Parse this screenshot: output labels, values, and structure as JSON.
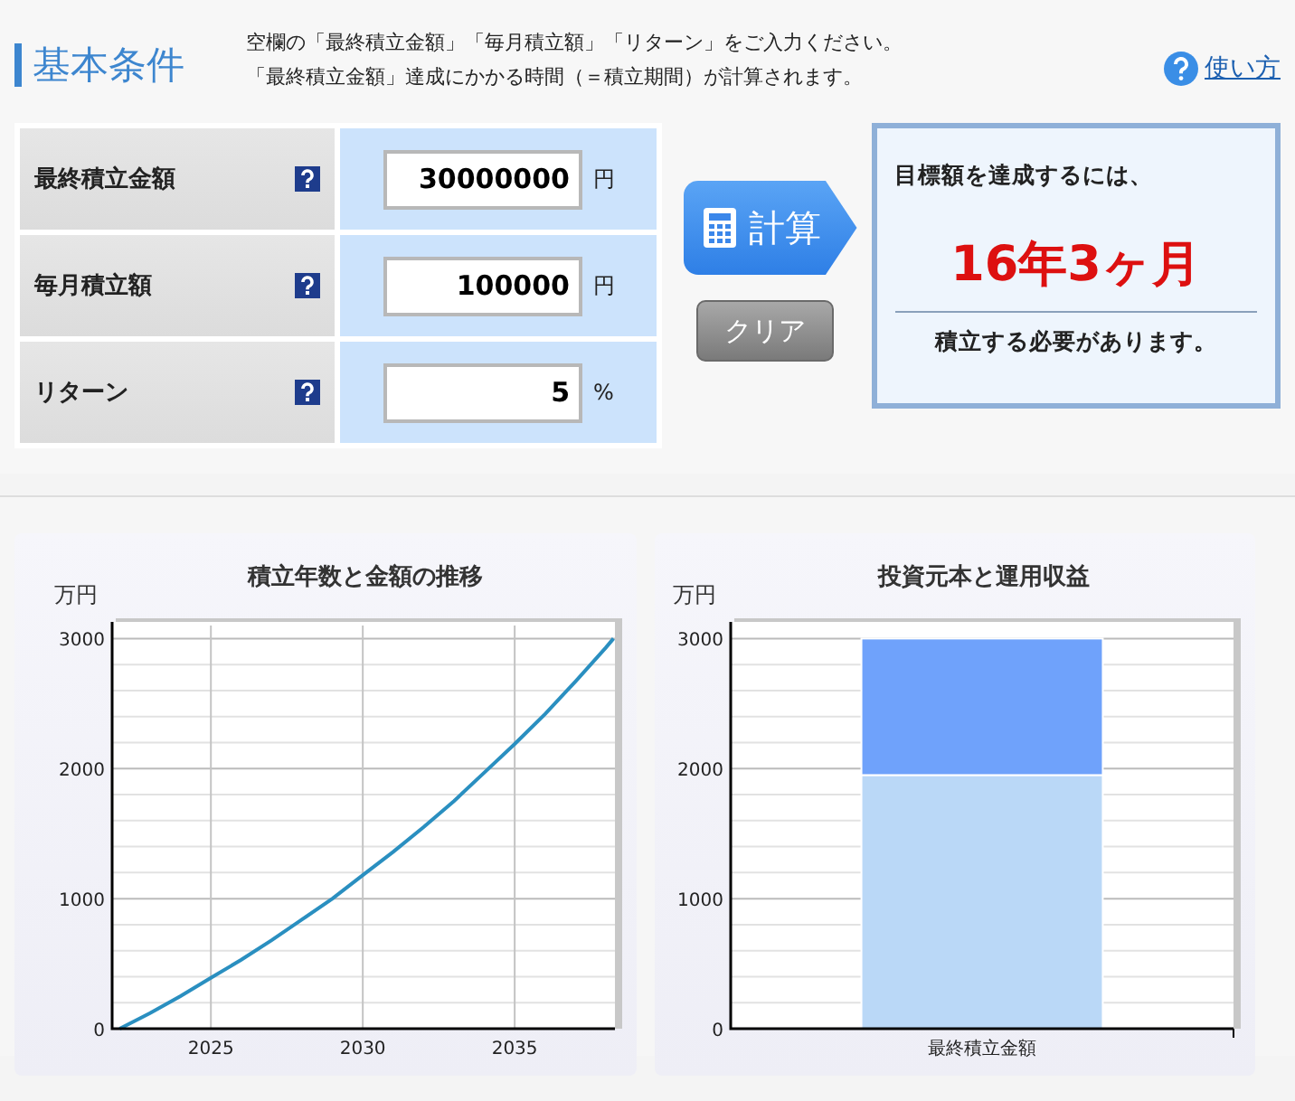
{
  "header": {
    "title": "基本条件",
    "instructions": [
      "空欄の「最終積立金額」「毎月積立額」「リターン」をご入力ください。",
      "「最終積立金額」達成にかかる時間（＝積立期間）が計算されます。"
    ],
    "help_link": "使い方"
  },
  "inputs": [
    {
      "label": "最終積立金額",
      "value": "30000000",
      "unit": "円"
    },
    {
      "label": "毎月積立額",
      "value": "100000",
      "unit": "円"
    },
    {
      "label": "リターン",
      "value": "5",
      "unit": "%"
    }
  ],
  "buttons": {
    "calculate": "計算",
    "clear": "クリア"
  },
  "result": {
    "lead": "目標額を達成するには、",
    "period": "16年3ヶ月",
    "tail": "積立する必要があります。"
  },
  "charts": [
    {
      "y_unit": "万円",
      "chart_data": {
        "type": "line",
        "title": "積立年数と金額の推移",
        "x": [
          2022,
          2023,
          2024,
          2025,
          2026,
          2027,
          2028,
          2029,
          2030,
          2031,
          2032,
          2033,
          2034,
          2035,
          2036,
          2037,
          2038,
          2038.25
        ],
        "series": [
          {
            "color": "#2a8fc0",
            "values": [
              0,
              120,
              250,
              390,
              530,
              680,
              840,
              1000,
              1180,
              1360,
              1550,
              1750,
              1970,
              2190,
              2420,
              2670,
              2930,
              3000
            ]
          }
        ],
        "grid": true,
        "xlim": [
          2021.75,
          2038.3
        ],
        "ylim": [
          0,
          3100
        ],
        "xticks": [
          2025,
          2030,
          2035
        ],
        "yticks": [
          0,
          1000,
          2000,
          3000
        ]
      }
    },
    {
      "y_unit": "万円",
      "chart_data": {
        "type": "bar",
        "title": "投資元本と運用収益",
        "categories": [
          "最終積立金額"
        ],
        "stacked": true,
        "grid": true,
        "series": [
          {
            "color": "#bad8f7",
            "values": [
              1950
            ]
          },
          {
            "color": "#6fa2fb",
            "values": [
              1050
            ]
          }
        ],
        "ylim": [
          0,
          3100
        ],
        "yticks": [
          0,
          1000,
          2000,
          3000
        ]
      }
    }
  ]
}
